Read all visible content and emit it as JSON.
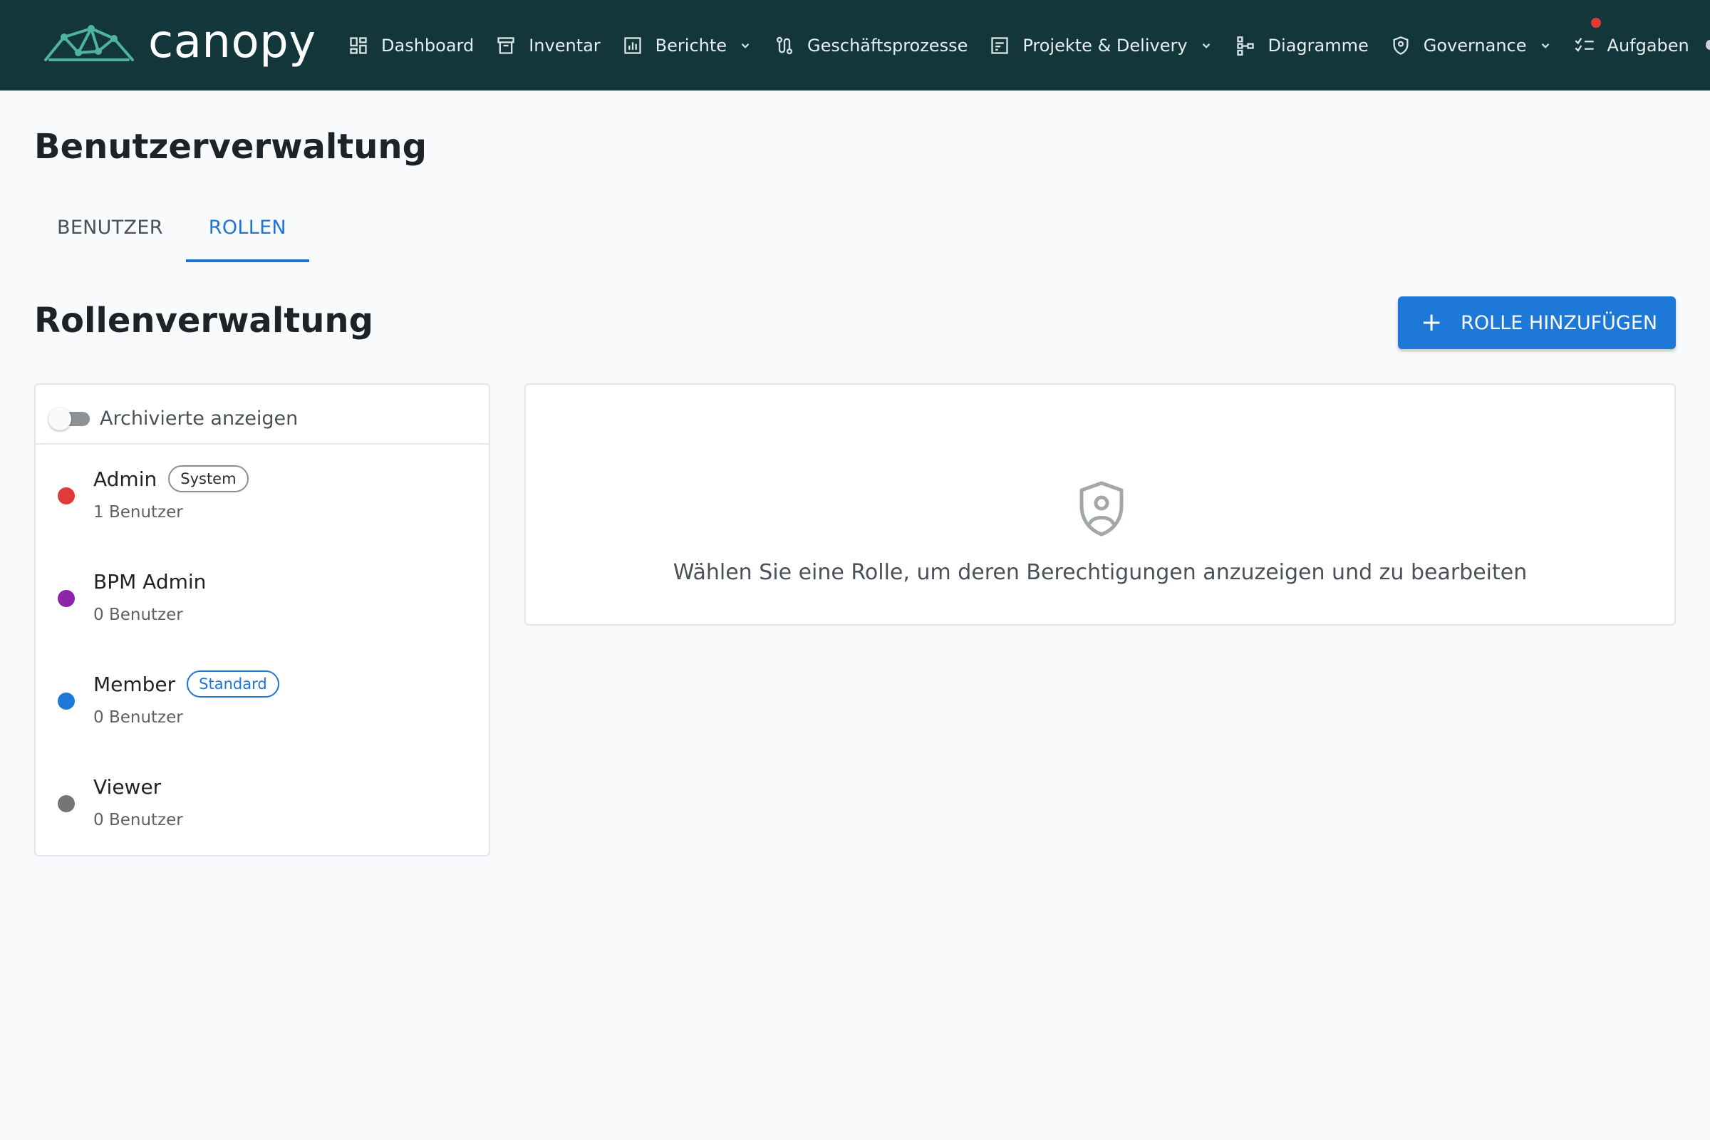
{
  "app": {
    "brand": "canopy"
  },
  "nav": {
    "items": [
      {
        "label": "Dashboard",
        "icon": "dashboard-icon",
        "dropdown": false
      },
      {
        "label": "Inventar",
        "icon": "archive-box-icon",
        "dropdown": false
      },
      {
        "label": "Berichte",
        "icon": "bar-chart-icon",
        "dropdown": true
      },
      {
        "label": "Geschäftsprozesse",
        "icon": "route-icon",
        "dropdown": false
      },
      {
        "label": "Projekte & Delivery",
        "icon": "task-board-icon",
        "dropdown": true
      },
      {
        "label": "Diagramme",
        "icon": "hierarchy-icon",
        "dropdown": false
      },
      {
        "label": "Governance",
        "icon": "shield-icon",
        "dropdown": true
      },
      {
        "label": "Aufgaben",
        "icon": "checklist-icon",
        "dropdown": false,
        "has_notification": true
      }
    ]
  },
  "page": {
    "title": "Benutzerverwaltung",
    "tabs": [
      {
        "label": "BENUTZER",
        "active": false
      },
      {
        "label": "ROLLEN",
        "active": true
      }
    ]
  },
  "roles_section": {
    "title": "Rollenverwaltung",
    "add_button_label": "ROLLE HINZUFÜGEN",
    "add_button_icon": "plus-icon",
    "show_archived_label": "Archivierte anzeigen",
    "show_archived": false,
    "roles": [
      {
        "name": "Admin",
        "badge": "System",
        "count": "1 Benutzer",
        "color": "#e03a3a"
      },
      {
        "name": "BPM Admin",
        "badge": "",
        "count": "0 Benutzer",
        "color": "#8e24aa"
      },
      {
        "name": "Member",
        "badge": "Standard",
        "count": "0 Benutzer",
        "color": "#1e78d8"
      },
      {
        "name": "Viewer",
        "badge": "",
        "count": "0 Benutzer",
        "color": "#757575"
      }
    ]
  },
  "detail": {
    "icon": "shield-user-icon",
    "empty_message": "Wählen Sie eine Rolle, um deren Berechtigungen anzuzeigen und zu bearbeiten"
  },
  "colors": {
    "topbar": "#12363a",
    "accent": "#1e78d8",
    "notification": "#e53935"
  }
}
